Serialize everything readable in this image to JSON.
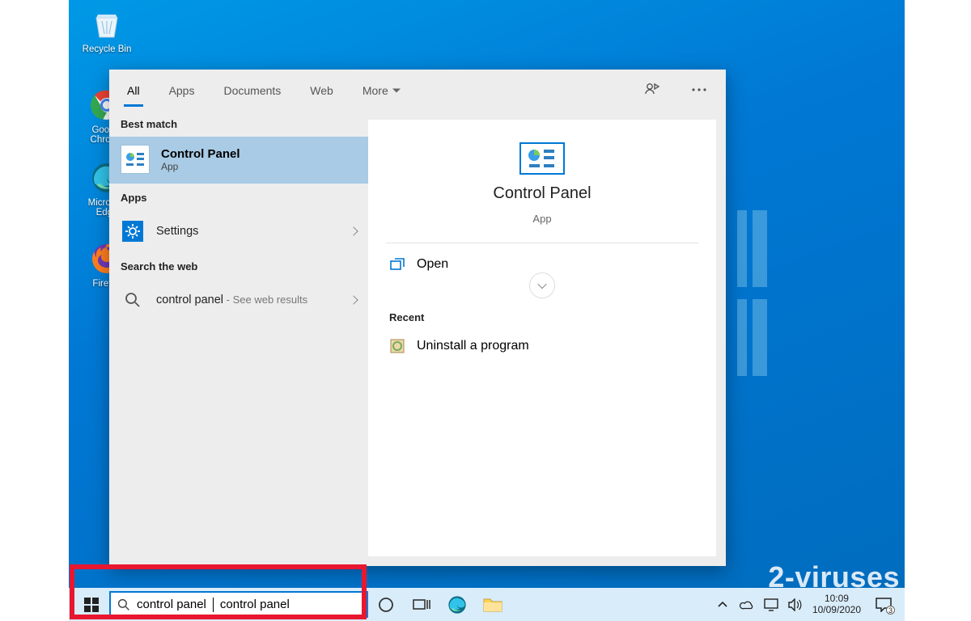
{
  "desktop_icons": {
    "recycle": "Recycle Bin",
    "chrome": "Google Chrome",
    "edge": "Microsoft Edge",
    "firefox": "Firefox"
  },
  "search_panel": {
    "tabs": {
      "all": "All",
      "apps": "Apps",
      "documents": "Documents",
      "web": "Web",
      "more": "More"
    },
    "sections": {
      "best": "Best match",
      "apps": "Apps",
      "web": "Search the web",
      "recent": "Recent"
    },
    "best_match": {
      "title": "Control Panel",
      "subtitle": "App"
    },
    "apps_item": {
      "label": "Settings"
    },
    "web_item": {
      "query": "control panel",
      "hint": " - See web results"
    },
    "preview": {
      "title": "Control Panel",
      "subtitle": "App",
      "open": "Open"
    },
    "recent_item": {
      "label": "Uninstall a program"
    }
  },
  "taskbar": {
    "search_value": "control panel",
    "clock_time": "10:09",
    "clock_date": "10/09/2020",
    "notif_count": "3"
  },
  "watermark": "2-viruses"
}
